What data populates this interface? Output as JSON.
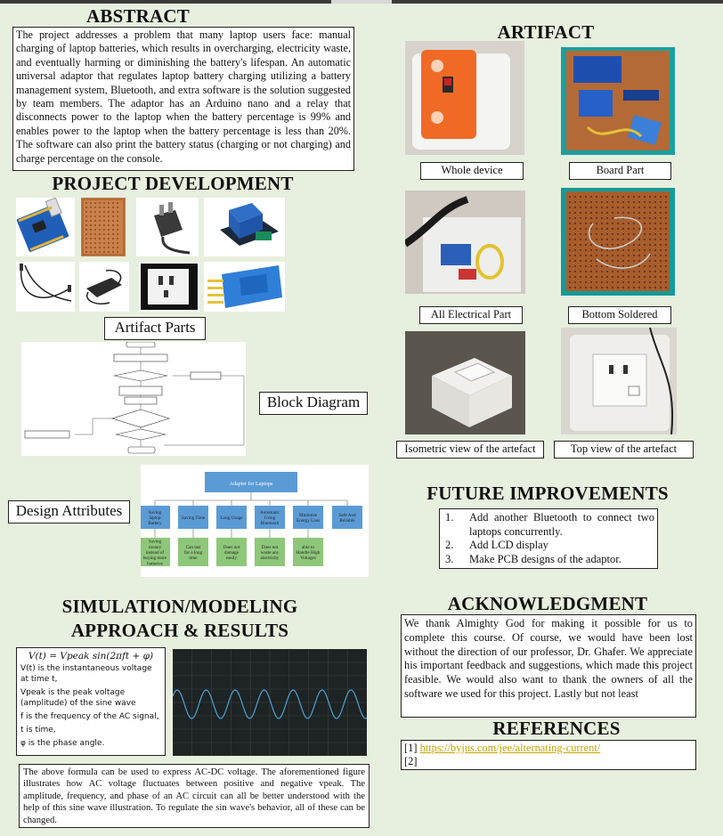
{
  "sections": {
    "abstract": "ABSTRACT",
    "project_development": "PROJECT DEVELOPMENT",
    "artifact": "ARTIFACT",
    "future_improvements": "FUTURE IMPROVEMENTS",
    "acknowledgment": "ACKNOWLEDGMENT",
    "simulation_line1": "SIMULATION/MODELING",
    "simulation_line2": "APPROACH & RESULTS",
    "references": "REFERENCES"
  },
  "abstract_text": "The project addresses a problem that many laptop users face: manual charging of laptop batteries, which results in overcharging, electricity waste, and eventually harming or diminishing the battery's lifespan. An automatic universal adaptor that regulates laptop battery charging utilizing a battery management system, Bluetooth, and extra software is the solution suggested by team members. The adaptor has an Arduino nano and a relay that disconnects power to the laptop when the battery percentage is 99% and enables power to the laptop when the battery percentage is less than 20%. The software can also print the battery status (charging or not charging) and charge percentage on the console.",
  "labels": {
    "artifact_parts": "Artifact Parts",
    "block_diagram": "Block Diagram",
    "design_attributes": "Design Attributes"
  },
  "artifact_captions": [
    "Whole device",
    "Board  Part",
    "All Electrical Part",
    "Bottom Soldered",
    "Isometric view of the artefact",
    "Top view of the artefact"
  ],
  "design_tree": {
    "root": "Adapter for Laptops",
    "attributes": [
      "Saving laptop Battery",
      "Saving Time",
      "Long Usage",
      "Automatic Using Bluetooth",
      "Minimize Energy Loss",
      "Safe And Reliable"
    ],
    "details": [
      "Saving money instead of buying more batteries",
      "Can last for a long time",
      "Does not damage easily",
      "Does not waste any electricity",
      "able to Handle High Voltages"
    ]
  },
  "equation": {
    "formula": "V(t) = Vpeak sin(2πft + φ)",
    "definitions": [
      "V(t) is the instantaneous voltage at time t,",
      "Vpeak is the peak voltage (amplitude) of the sine wave",
      "f is the frequency of the AC signal,",
      "t is time,",
      "φ is the phase angle."
    ]
  },
  "simulation_text": "The above formula can be used to express AC-DC voltage. The aforementioned figure illustrates how AC voltage fluctuates between positive and negative vpeak. The amplitude, frequency, and phase of an AC circuit can all be better understood with the help of this sine wave illustration. To regulate the sin wave's behavior, all of these can be changed.",
  "future_improvements": [
    {
      "num": "1.",
      "text": "Add another Bluetooth to connect two laptops concurrently."
    },
    {
      "num": "2.",
      "text": "Add LCD display"
    },
    {
      "num": "3.",
      "text": "Make PCB designs of the adaptor."
    }
  ],
  "acknowledgment_text": "We thank Almighty God for making it possible for us to complete this course. Of course, we would have been lost without the direction of our professor, Dr. Ghafer. We appreciate his important feedback and suggestions, which made this project feasible. We would also want to thank the owners of all the software we used for this project. Lastly but not least",
  "references": [
    {
      "num": "[1]",
      "url": "https://byjus.com/jee/alternating-current/"
    },
    {
      "num": "[2]",
      "url": ""
    }
  ],
  "colors": {
    "background": "#e7efde",
    "diagram_blue": "#5b9bd5",
    "diagram_green": "#8ec77a",
    "scope_bg": "#1e2323",
    "scope_wave": "#4aa3d8",
    "link": "#c8a400"
  },
  "icons": [
    "arduino-nano-icon",
    "perfboard-icon",
    "power-plug-icon",
    "relay-module-icon",
    "jumper-wires-icon",
    "power-adapter-icon",
    "wall-socket-icon",
    "bluetooth-module-icon"
  ]
}
